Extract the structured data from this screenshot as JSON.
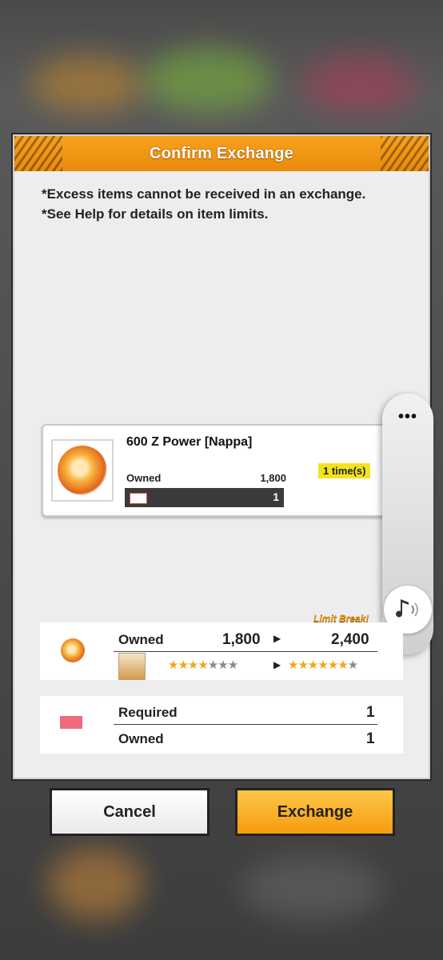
{
  "dialog": {
    "title": "Confirm Exchange",
    "notes": [
      "*Excess items cannot be received in an exchange.",
      "*See Help for details on item limits."
    ]
  },
  "item": {
    "name": "600 Z Power [Nappa]",
    "times": "1 time(s)",
    "owned_label": "Owned",
    "owned_value": "1,800",
    "ticket_count": "1"
  },
  "side_panel": {
    "menu": "•••",
    "music_icon": "music-note-icon"
  },
  "limit_break": "Limit Break!",
  "power": {
    "owned_label": "Owned",
    "from": "1,800",
    "to": "2,400",
    "stars_from": {
      "lit": 4,
      "total": 7
    },
    "stars_to": {
      "lit": 6,
      "total": 7
    }
  },
  "requirement": {
    "required_label": "Required",
    "required_value": "1",
    "owned_label": "Owned",
    "owned_value": "1"
  },
  "buttons": {
    "cancel": "Cancel",
    "exchange": "Exchange"
  },
  "colors": {
    "accent": "#f59b0e",
    "badge": "#f2e41c",
    "star": "#f2a515"
  }
}
